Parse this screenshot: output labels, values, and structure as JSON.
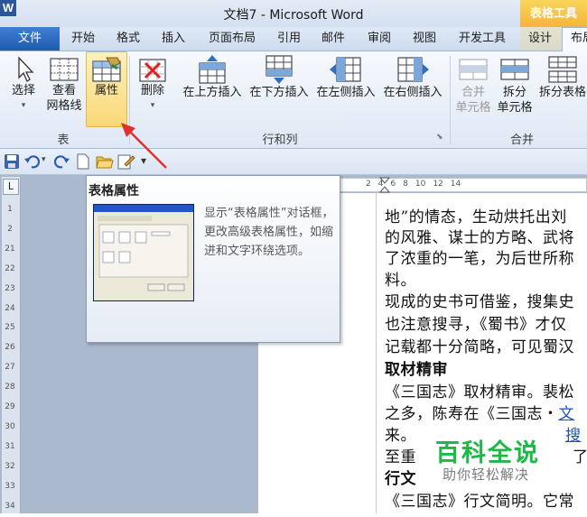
{
  "window": {
    "title": "文档7 - Microsoft Word",
    "contextual_tab_group": "表格工具",
    "app_icon": "W"
  },
  "ribbon_tabs": {
    "file": "文件",
    "items": [
      "开始",
      "格式",
      "插入",
      "页面布局",
      "引用",
      "邮件",
      "审阅",
      "视图",
      "开发工具",
      "设计",
      "布局"
    ]
  },
  "ribbon": {
    "select": "选择",
    "view_gridlines_1": "查看",
    "view_gridlines_2": "网格线",
    "properties": "属性",
    "delete": "删除",
    "insert_above": "在上方插入",
    "insert_below": "在下方插入",
    "insert_left": "在左侧插入",
    "insert_right": "在右侧插入",
    "merge_1": "合并",
    "merge_2": "单元格",
    "split_1": "拆分",
    "split_2": "单元格",
    "split_table": "拆分表格",
    "group_table": "表",
    "group_rows_cols": "行和列",
    "group_merge": "合并"
  },
  "ruler": {
    "corner": "L",
    "h_marks": [
      "8",
      "6",
      "4",
      "2",
      "2",
      "4",
      "6",
      "8",
      "10",
      "12",
      "14"
    ],
    "v_marks": [
      "1",
      "2",
      "21",
      "22",
      "23",
      "24",
      "25",
      "26",
      "27",
      "28",
      "29",
      "30",
      "31",
      "32",
      "33",
      "34"
    ]
  },
  "tooltip": {
    "title": "表格属性",
    "description": "显示“表格属性”对话框，更改高级表格属性，如缩进和文字环绕选项。"
  },
  "document": {
    "lines": [
      "地”的情态，生动烘托出刘",
      "的风雅、谋士的方略、武将",
      "了浓重的一笔，为后世所称",
      "料。"
    ],
    "lines2": [
      "现成的史书可借鉴，搜集史",
      "也注意搜寻，《蜀书》才仅",
      "记载都十分简略，可见蜀汉"
    ],
    "heading1": "取材精审",
    "p3_line1": "《三国志》取材精审。裴松",
    "p3_line2_a": "之多，陈寿在《三国志・",
    "p3_line2_link": "文",
    "p3_line3_a": "来。",
    "p3_line3_link": "搜",
    "p3_line4_a": "至重",
    "p3_line4_b": "了",
    "heading2": "行文",
    "p4_line1": "《三国志》行文简明。它常"
  },
  "watermark": {
    "main": "百科全说",
    "sub": "助你轻松解决"
  },
  "colors": {
    "file_tab": "#2a63b8",
    "contextual": "#f5c04a",
    "watermark": "#1cba45",
    "arrow": "#e03030"
  }
}
